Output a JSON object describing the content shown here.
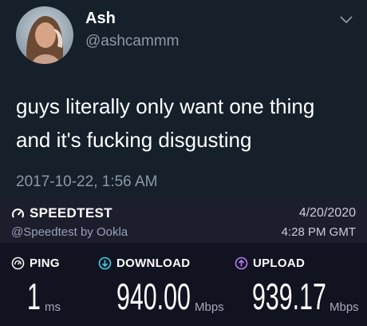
{
  "tweet": {
    "display_name": "Ash",
    "handle": "@ashcammm",
    "text_lines": [
      "guys literally only want one thing",
      "and it's fucking disgusting"
    ],
    "timestamp": "2017-10-22, 1:56 AM",
    "menu_icon": "chevron-down-icon"
  },
  "speedtest": {
    "brand": "SPEEDTEST",
    "brand_handle": "@Speedtest by Ookla",
    "date": "4/20/2020",
    "time": "4:28 PM GMT",
    "ping": {
      "label": "PING",
      "value": "1",
      "unit": "ms",
      "icon": "gauge-icon",
      "color": "#f2f2f2"
    },
    "download": {
      "label": "DOWNLOAD",
      "value": "940.00",
      "unit": "Mbps",
      "icon": "arrow-down-circle-icon",
      "color": "#3ad4e6"
    },
    "upload": {
      "label": "UPLOAD",
      "value": "939.17",
      "unit": "Mbps",
      "icon": "arrow-up-circle-icon",
      "color": "#b57cf5"
    }
  }
}
